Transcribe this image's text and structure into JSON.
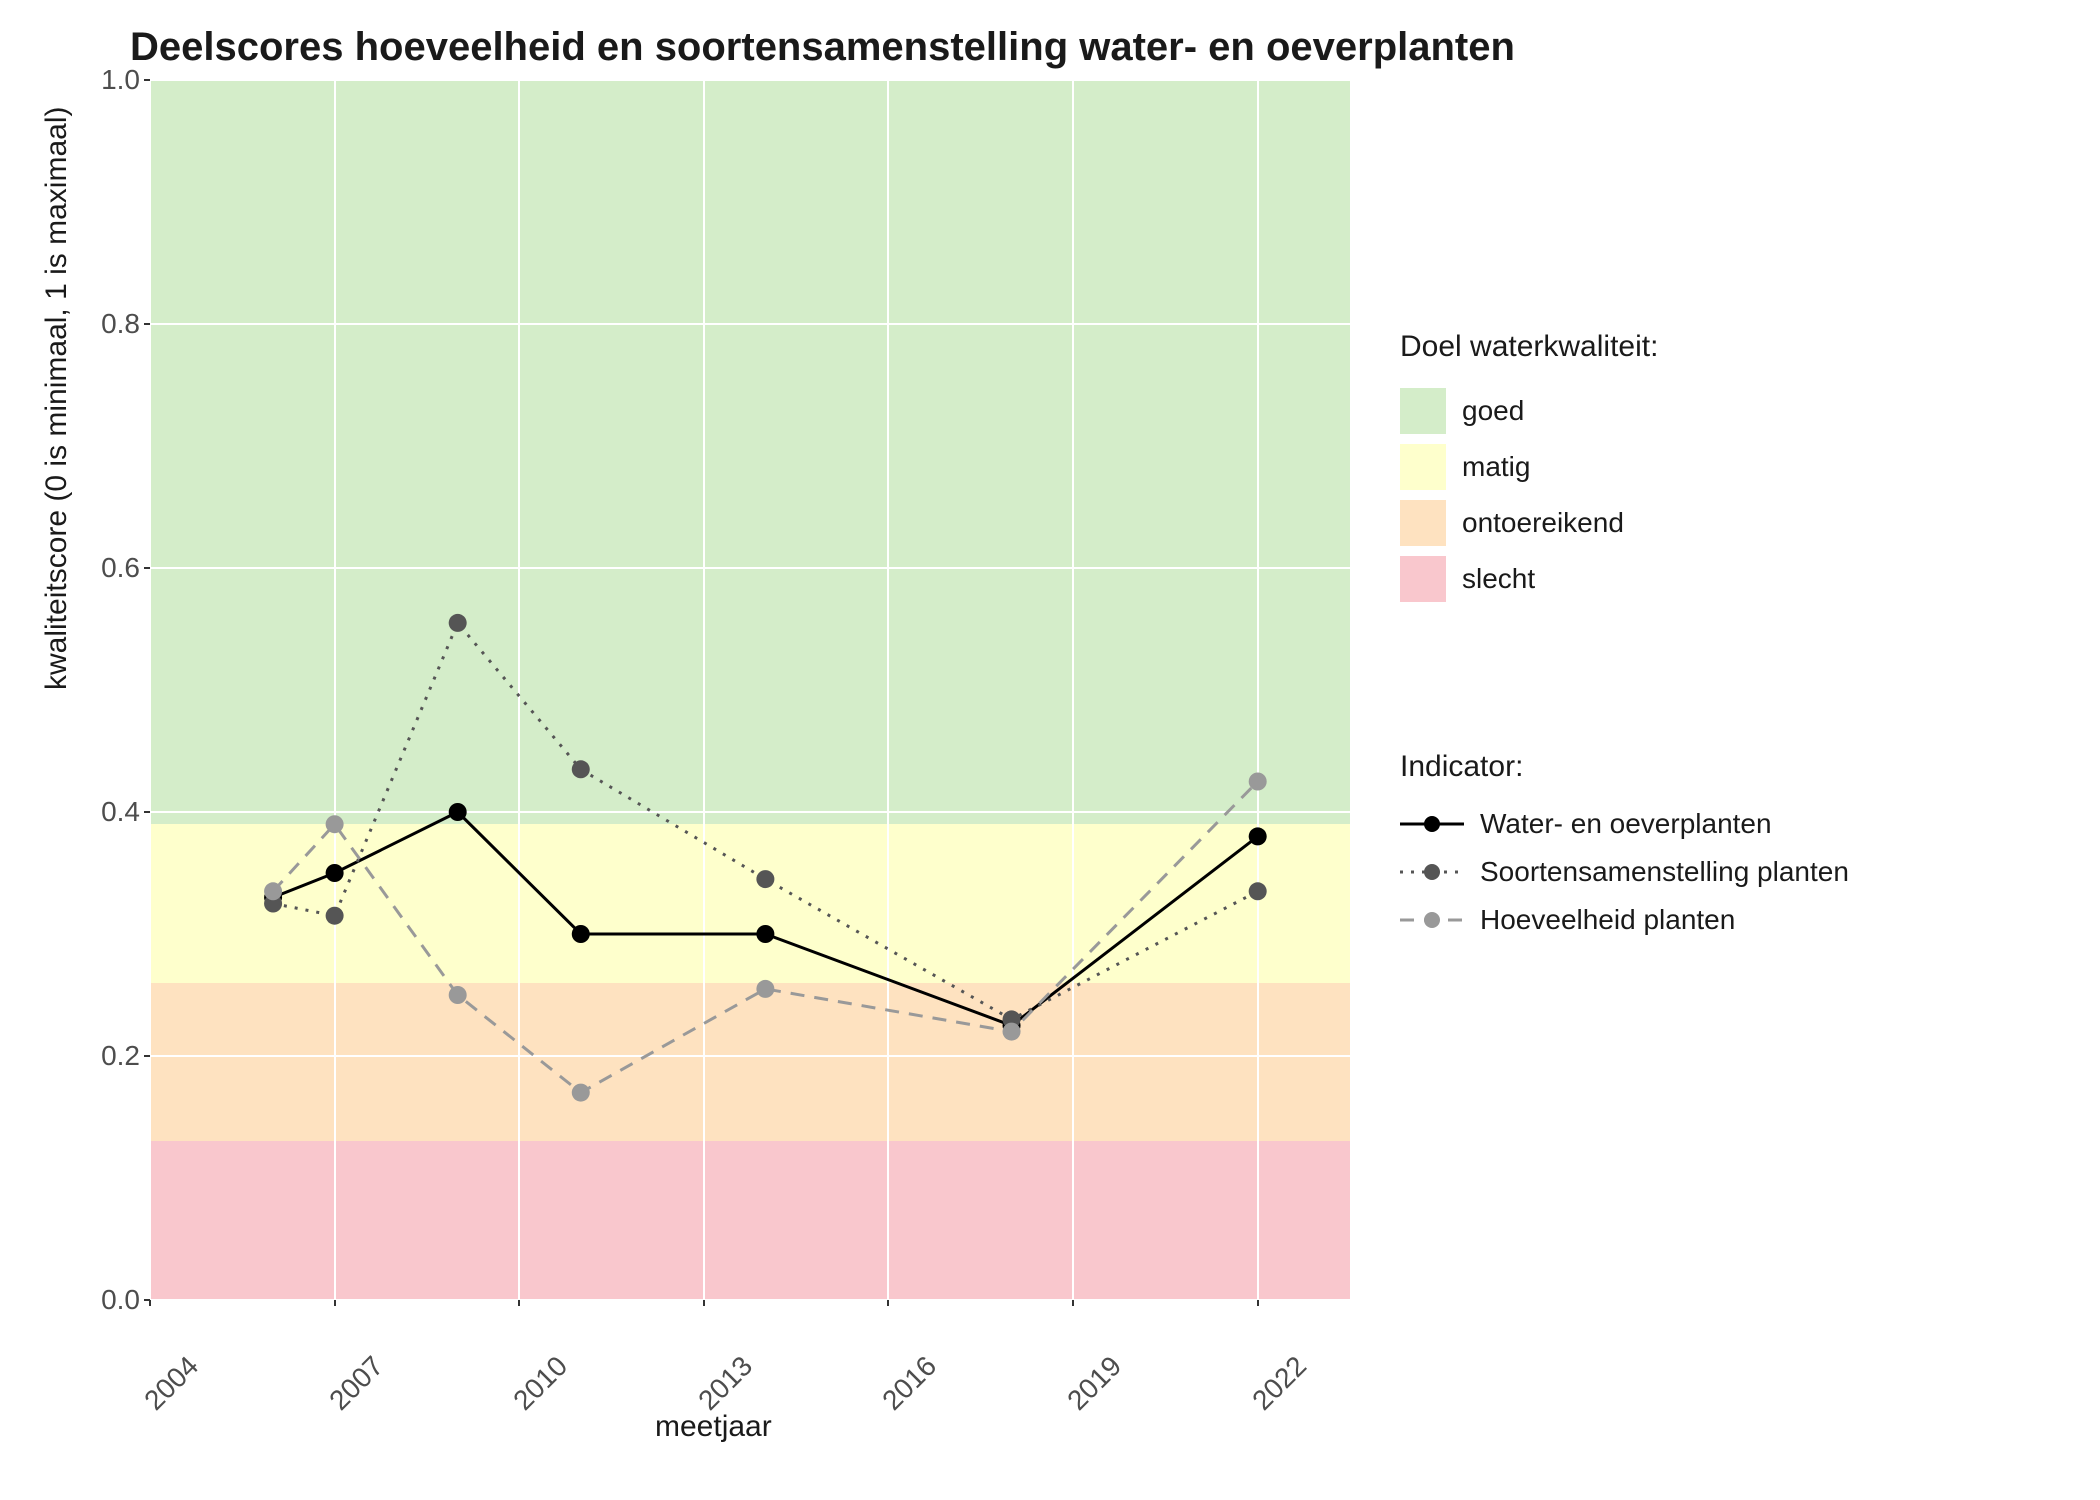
{
  "chart_data": {
    "type": "line",
    "title": "Deelscores hoeveelheid en soortensamenstelling water- en oeverplanten",
    "xlabel": "meetjaar",
    "ylabel": "kwaliteitscore (0 is minimaal, 1 is maximaal)",
    "xlim": [
      2004,
      2023.5
    ],
    "ylim": [
      0.0,
      1.0
    ],
    "x_ticks": [
      2004,
      2007,
      2010,
      2013,
      2016,
      2019,
      2022
    ],
    "y_ticks": [
      0.0,
      0.2,
      0.4,
      0.6,
      0.8,
      1.0
    ],
    "bands": [
      {
        "name": "goed",
        "from": 0.39,
        "to": 1.0,
        "color": "#d4edc9"
      },
      {
        "name": "matig",
        "from": 0.26,
        "to": 0.39,
        "color": "#feffcc"
      },
      {
        "name": "ontoereikend",
        "from": 0.13,
        "to": 0.26,
        "color": "#fee2c0"
      },
      {
        "name": "slecht",
        "from": 0.0,
        "to": 0.13,
        "color": "#f9c7cd"
      }
    ],
    "series": [
      {
        "name": "Water- en oeverplanten",
        "color": "#000000",
        "dash": "solid",
        "x": [
          2006,
          2007,
          2009,
          2011,
          2014,
          2018,
          2022
        ],
        "y": [
          0.33,
          0.35,
          0.4,
          0.3,
          0.3,
          0.225,
          0.38
        ]
      },
      {
        "name": "Soortensamenstelling planten",
        "color": "#555555",
        "dash": "dotted",
        "x": [
          2006,
          2007,
          2009,
          2011,
          2014,
          2018,
          2022
        ],
        "y": [
          0.325,
          0.315,
          0.555,
          0.435,
          0.345,
          0.23,
          0.335
        ]
      },
      {
        "name": "Hoeveelheid planten",
        "color": "#999999",
        "dash": "dashed",
        "x": [
          2006,
          2007,
          2009,
          2011,
          2014,
          2018,
          2022
        ],
        "y": [
          0.335,
          0.39,
          0.25,
          0.17,
          0.255,
          0.22,
          0.425
        ]
      }
    ],
    "legend1_title": "Doel waterkwaliteit:",
    "legend1_items": [
      "goed",
      "matig",
      "ontoereikend",
      "slecht"
    ],
    "legend2_title": "Indicator:",
    "legend2_items": [
      "Water- en oeverplanten",
      "Soortensamenstelling planten",
      "Hoeveelheid planten"
    ]
  }
}
